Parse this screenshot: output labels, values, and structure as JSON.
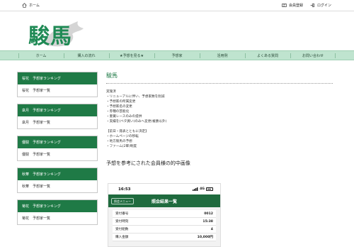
{
  "topbar": {
    "home_label": "ホーム",
    "register_label": "会員登録",
    "login_label": "ログイン"
  },
  "logo": {
    "text": "駿馬"
  },
  "nav": {
    "items": [
      "ホーム",
      "購入の流れ",
      "★予想を見る★",
      "予想家",
      "活用例",
      "よくある質問",
      "お問い合わせ"
    ]
  },
  "sidebar": {
    "blocks": [
      {
        "head": "桜花　予想家ランキング",
        "link": "桜花　予想家一覧"
      },
      {
        "head": "皐月　予想家ランキング",
        "link": "皐月　予想家一覧"
      },
      {
        "head": "優駿　予想家ランキング",
        "link": "優駿　予想家一覧"
      },
      {
        "head": "秋華　予想家ランキング",
        "link": "秋華　予想家一覧"
      },
      {
        "head": "菊花　予想家ランキング",
        "link": "菊花　予想家一覧"
      }
    ]
  },
  "main": {
    "title": "駿馬",
    "section1": [
      "実施済",
      "・リニューアルに伴い、予想家数を削減",
      "・予想家の所属変更",
      "・予想家名の変更",
      "・券種の芸能化",
      "・重賞レースのみの提供",
      "・実績を(ベタ買い)のみへ変更(複勝以外)"
    ],
    "section2": [
      "【前日・発表とともに決定】",
      "・ホームページの移転",
      "・地方競馬の予想",
      "・ファーム(2軍)制度"
    ],
    "heading2": "予想を参考にされた会員様の的中画像"
  },
  "phone": {
    "time": "16:53",
    "signal": "4G",
    "menu_button": "照会メニュー",
    "title": "照会結果一覧",
    "rows": [
      {
        "label": "受付番号",
        "value": "0012"
      },
      {
        "label": "受付時刻",
        "value": "15:38"
      },
      {
        "label": "受付組数",
        "value": "4"
      },
      {
        "label": "購入金額",
        "value": "10,000円"
      }
    ]
  },
  "colors": {
    "brand_green": "#1f7a46",
    "nav_bg": "#bfe4cf",
    "logo_green": "#1f8a55"
  }
}
